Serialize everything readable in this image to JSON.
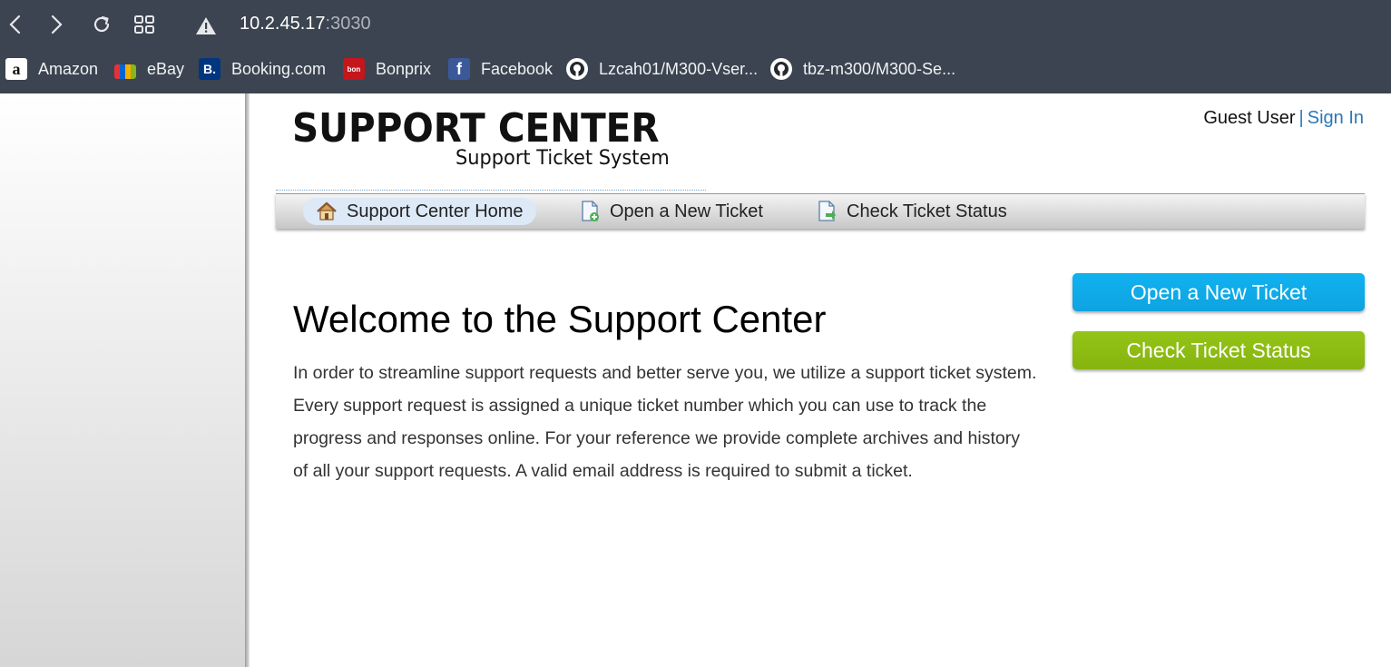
{
  "browser": {
    "address": {
      "host": "10.2.45.17",
      "port": ":3030"
    },
    "bookmarks": [
      {
        "label": "Amazon",
        "icon": "amazon-icon"
      },
      {
        "label": "eBay",
        "icon": "ebay-icon"
      },
      {
        "label": "Booking.com",
        "icon": "booking-icon"
      },
      {
        "label": "Bonprix",
        "icon": "bonprix-icon"
      },
      {
        "label": "Facebook",
        "icon": "facebook-icon"
      },
      {
        "label": "Lzcah01/M300-Vser...",
        "icon": "github-icon"
      },
      {
        "label": "tbz-m300/M300-Se...",
        "icon": "github-icon"
      }
    ]
  },
  "header": {
    "logo_title": "SUPPORT CENTER",
    "logo_subtitle": "Support Ticket System",
    "user_name": "Guest User",
    "separator": "|",
    "sign_in": "Sign In"
  },
  "nav": {
    "items": [
      {
        "label": "Support Center Home",
        "icon": "home-icon",
        "active": true
      },
      {
        "label": "Open a New Ticket",
        "icon": "new-ticket-icon",
        "active": false
      },
      {
        "label": "Check Ticket Status",
        "icon": "ticket-status-icon",
        "active": false
      }
    ]
  },
  "main": {
    "title": "Welcome to the Support Center",
    "body": "In order to streamline support requests and better serve you, we utilize a support ticket system. Every support request is assigned a unique ticket number which you can use to track the progress and responses online. For your reference we provide complete archives and history of all your support requests. A valid email address is required to submit a ticket."
  },
  "sidebar": {
    "open_ticket_button": "Open a New Ticket",
    "check_status_button": "Check Ticket Status"
  },
  "colors": {
    "chrome_bg": "#3b4450",
    "link": "#2b78b8",
    "open_button": "#0ea3e0",
    "status_button": "#86b40f"
  }
}
